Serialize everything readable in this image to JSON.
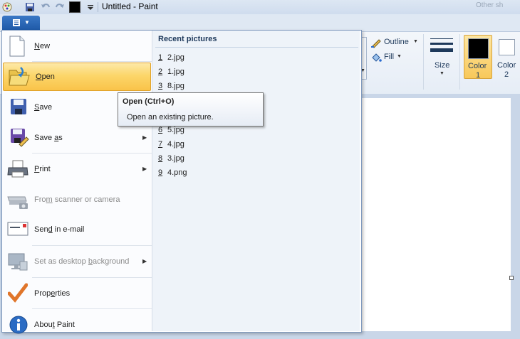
{
  "window": {
    "title": "Untitled - Paint",
    "title_right_faded": "Other sh"
  },
  "quick_access": {
    "icons": [
      "paint-app-icon",
      "save-icon",
      "undo-icon",
      "redo-icon",
      "color-swatch-icon",
      "customize-dropdown-icon"
    ]
  },
  "ribbon": {
    "outline_label": "Outline",
    "fill_label": "Fill",
    "size_label": "Size",
    "color1_label": "Color 1",
    "color1_line1": "Color",
    "color1_line2": "1",
    "color2_line1": "Color",
    "color2_line2": "2",
    "color1_value": "#000000",
    "color2_value": "#ffffff"
  },
  "app_menu": {
    "items": [
      {
        "key": "new",
        "label": "New",
        "mnemonic": "N",
        "submenu": false,
        "enabled": true
      },
      {
        "key": "open",
        "label": "Open",
        "mnemonic": "O",
        "submenu": false,
        "enabled": true,
        "highlighted": true
      },
      {
        "key": "save",
        "label": "Save",
        "mnemonic": "S",
        "submenu": false,
        "enabled": true
      },
      {
        "key": "save_as",
        "label": "Save as",
        "mnemonic": "a",
        "submenu": true,
        "enabled": true
      },
      {
        "key": "print",
        "label": "Print",
        "mnemonic": "P",
        "submenu": true,
        "enabled": true
      },
      {
        "key": "from_scanner",
        "label": "From scanner or camera",
        "mnemonic": "m",
        "submenu": false,
        "enabled": false
      },
      {
        "key": "send_email",
        "label": "Send in e-mail",
        "mnemonic": "d",
        "submenu": false,
        "enabled": true
      },
      {
        "key": "desktop_bg",
        "label": "Set as desktop background",
        "mnemonic": "b",
        "submenu": true,
        "enabled": false
      },
      {
        "key": "properties",
        "label": "Properties",
        "mnemonic": "e",
        "submenu": false,
        "enabled": true
      },
      {
        "key": "about",
        "label": "About Paint",
        "mnemonic": "t",
        "submenu": false,
        "enabled": true
      }
    ],
    "recent_title": "Recent pictures",
    "recent": [
      {
        "num": "1",
        "name": "2.jpg"
      },
      {
        "num": "2",
        "name": "1.jpg"
      },
      {
        "num": "3",
        "name": "8.jpg"
      },
      {
        "num": "6",
        "name": "5.jpg"
      },
      {
        "num": "7",
        "name": "4.jpg"
      },
      {
        "num": "8",
        "name": "3.jpg"
      },
      {
        "num": "9",
        "name": "4.png"
      }
    ]
  },
  "tooltip": {
    "title": "Open (Ctrl+O)",
    "description": "Open an existing picture."
  }
}
